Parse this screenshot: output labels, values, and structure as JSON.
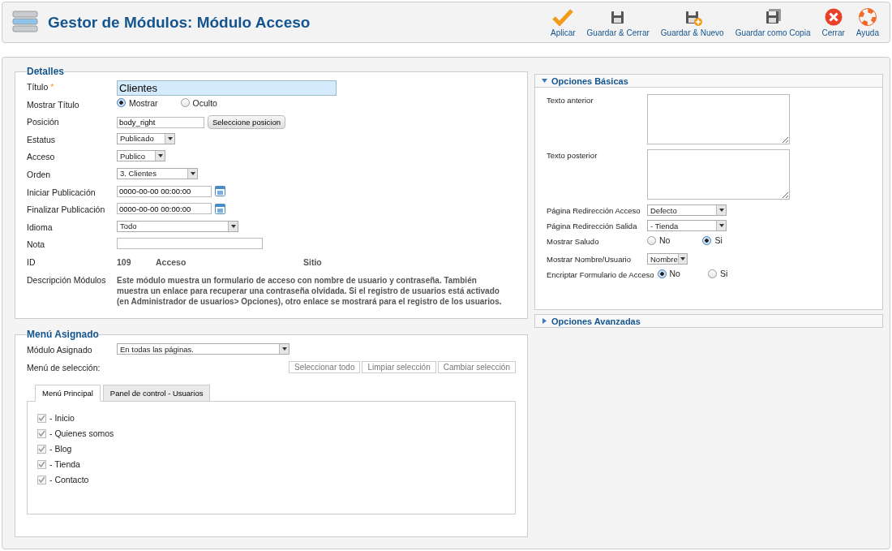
{
  "header": {
    "title": "Gestor de Módulos: Módulo Acceso"
  },
  "toolbar": [
    {
      "label": "Aplicar",
      "kind": "apply"
    },
    {
      "label": "Guardar & Cerrar",
      "kind": "save"
    },
    {
      "label": "Guardar & Nuevo",
      "kind": "save-new"
    },
    {
      "label": "Guardar como Copia",
      "kind": "save-copy"
    },
    {
      "label": "Cerrar",
      "kind": "close"
    },
    {
      "label": "Ayuda",
      "kind": "help"
    }
  ],
  "details": {
    "legend": "Detalles",
    "fields": [
      {
        "kind": "title",
        "label": "Título",
        "required_mark": "*",
        "value": "Clientes"
      },
      {
        "kind": "radio",
        "label": "Mostrar Título",
        "options": [
          {
            "label": "Mostrar",
            "selected": true
          },
          {
            "label": "Oculto",
            "selected": false
          }
        ]
      },
      {
        "kind": "text-button",
        "label": "Posición",
        "value": "body_right",
        "button": "Seleccione posicion"
      },
      {
        "kind": "select",
        "label": "Estatus",
        "value": "Publicado"
      },
      {
        "kind": "select",
        "label": "Acceso",
        "value": "Publico"
      },
      {
        "kind": "select",
        "label": "Orden",
        "value": "3. Clientes"
      },
      {
        "kind": "date",
        "label": "Iniciar Publicación",
        "value": "0000-00-00 00:00:00"
      },
      {
        "kind": "date",
        "label": "Finalizar Publicación",
        "value": "0000-00-00 00:00:00"
      },
      {
        "kind": "select",
        "label": "Idioma",
        "value": "Todo"
      },
      {
        "kind": "text",
        "label": "Nota"
      },
      {
        "kind": "info",
        "label": "ID",
        "values": [
          "109",
          "Acceso",
          "Sitio"
        ]
      },
      {
        "kind": "description",
        "label": "Descripción Módulos",
        "text": "Este módulo muestra un formulario de acceso con nombre de usuario y contraseña. También muestra un enlace para recuperar una contraseña olvidada. Si el registro de usuarios está activado (en Administrador de usuarios> Opciones), otro enlace se mostrará para el registro de los usuarios."
      }
    ]
  },
  "menu_assignment": {
    "legend": "Menú Asignado",
    "module_label": "Módulo Asignado",
    "module_value": "En todas las páginas.",
    "selection_label": "Menú de selección:",
    "buttons": [
      "Seleccionar todo",
      "Limpiar selección",
      "Cambiar selección"
    ],
    "tabs": [
      {
        "label": "Menú Principal",
        "selected": true
      },
      {
        "label": "Panel de control - Usuarios",
        "selected": false
      }
    ],
    "items": [
      {
        "label": "- Inicio",
        "checked": true
      },
      {
        "label": "- Quienes somos",
        "checked": true
      },
      {
        "label": "- Blog",
        "checked": true
      },
      {
        "label": "- Tienda",
        "checked": true
      },
      {
        "label": "- Contacto",
        "checked": true
      }
    ]
  },
  "option_panels": [
    {
      "title": "Opciones Básicas",
      "expanded": true,
      "fields": [
        {
          "kind": "textarea",
          "label": "Texto anterior"
        },
        {
          "kind": "textarea",
          "label": "Texto posterior"
        },
        {
          "kind": "select",
          "label": "Página Redirección Acceso",
          "value": "Defecto"
        },
        {
          "kind": "select",
          "label": "Página Redirección Salida",
          "value": "- Tienda"
        },
        {
          "kind": "radio",
          "label": "Mostrar Saludo",
          "options": [
            {
              "label": "No",
              "selected": false
            },
            {
              "label": "Si",
              "selected": true
            }
          ]
        },
        {
          "kind": "select",
          "label": "Mostrar Nombre/Usuario",
          "value": "Nombre"
        },
        {
          "kind": "radio",
          "label": "Encriptar Formulario de Acceso",
          "options": [
            {
              "label": "No",
              "selected": true
            },
            {
              "label": "Si",
              "selected": false
            }
          ]
        }
      ]
    },
    {
      "title": "Opciones Avanzadas",
      "expanded": false
    }
  ]
}
